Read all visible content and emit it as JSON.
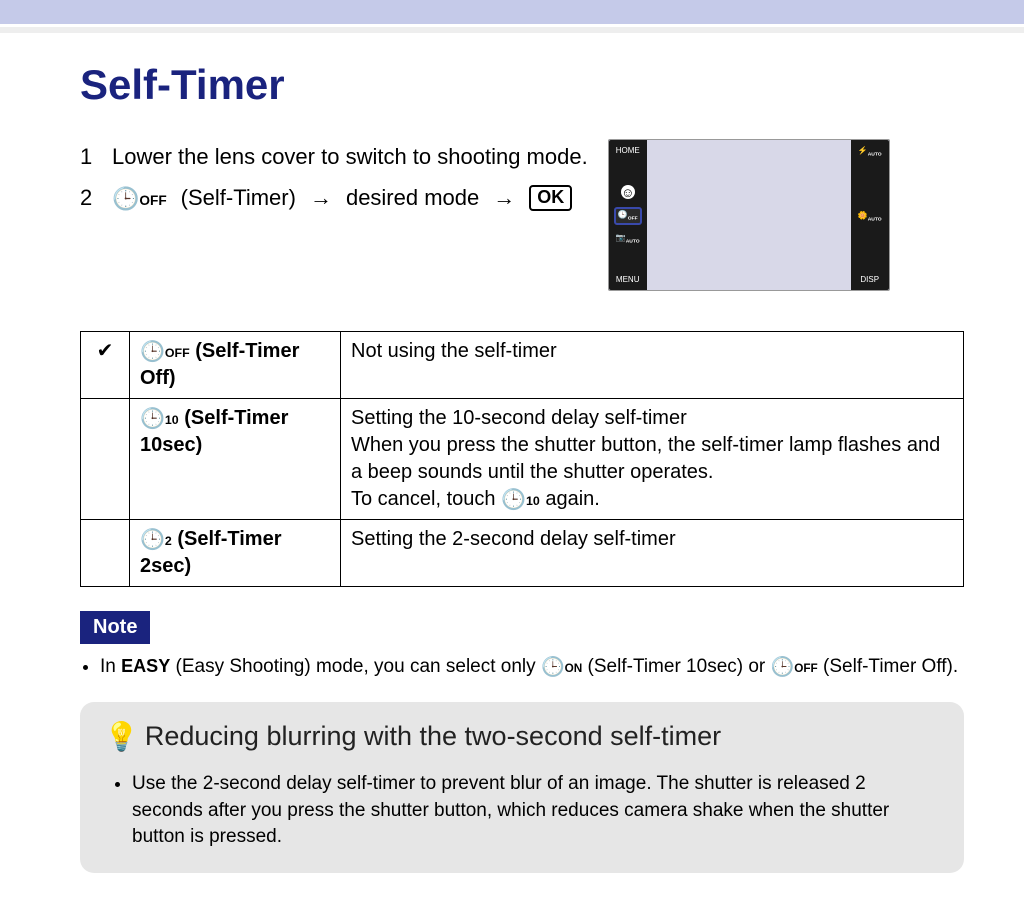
{
  "title": "Self-Timer",
  "steps": {
    "s1_num": "1",
    "s1_text": "Lower the lens cover to switch to shooting mode.",
    "s2_num": "2",
    "s2_icon_sub": "OFF",
    "s2_label": "(Self-Timer)",
    "s2_arrow1": "→",
    "s2_mid": "desired mode",
    "s2_arrow2": "→",
    "s2_ok": "OK"
  },
  "screen": {
    "left_top": "HOME",
    "left_b1_sub": "OFF",
    "left_b2": "AUTO",
    "left_bottom": "MENU",
    "right_top": "AUTO",
    "right_mid": "AUTO",
    "right_bottom": "DISP"
  },
  "table": {
    "check": "✔",
    "r1_icon_sub": "OFF",
    "r1_name": "(Self-Timer Off)",
    "r1_desc": "Not using the self-timer",
    "r2_icon_sub": "10",
    "r2_name": "(Self-Timer 10sec)",
    "r2_desc_l1": "Setting the 10-second delay self-timer",
    "r2_desc_l2": "When you press the shutter button, the self-timer lamp flashes and a beep sounds until the shutter operates.",
    "r2_desc_l3_a": "To cancel, touch ",
    "r2_desc_l3_b": " again.",
    "r2_desc_icon_sub": "10",
    "r3_icon_sub": "2",
    "r3_name": "(Self-Timer 2sec)",
    "r3_desc": "Setting the 2-second delay self-timer"
  },
  "note": {
    "badge": "Note",
    "text_a": "In ",
    "easy": "EASY",
    "text_b": " (Easy Shooting) mode, you can select only ",
    "icon1_sub": "ON",
    "text_c": " (Self-Timer 10sec) or ",
    "icon2_sub": "OFF",
    "text_d": " (Self-Timer Off)."
  },
  "tip": {
    "title": "Reducing blurring with the two-second self-timer",
    "bullet": "Use the 2-second delay self-timer to prevent blur of an image. The shutter is released 2 seconds after you press the shutter button, which reduces camera shake when the shutter button is pressed."
  }
}
